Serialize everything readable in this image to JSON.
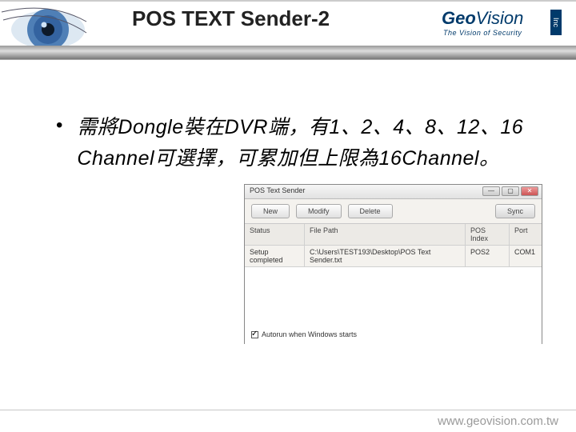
{
  "header": {
    "title": "POS TEXT Sender-2",
    "brand_name": "Geo",
    "brand_name2": "Vision",
    "brand_sub": "The Vision of Security",
    "inc": "Inc"
  },
  "bullet": {
    "dot": "•",
    "text": "需將Dongle裝在DVR端，有1、2、4、8、12、16 Channel可選擇，可累加但上限為16Channel。"
  },
  "shot": {
    "window_title": "POS Text Sender",
    "win_min": "—",
    "win_max": "▢",
    "win_close": "✕",
    "btn_new": "New",
    "btn_modify": "Modify",
    "btn_delete": "Delete",
    "btn_sync": "Sync",
    "col_status": "Status",
    "col_path": "File Path",
    "col_index": "POS Index",
    "col_port": "Port",
    "row_status": "Setup completed",
    "row_path": "C:\\Users\\TEST193\\Desktop\\POS Text Sender.txt",
    "row_index": "POS2",
    "row_port": "COM1",
    "autorun": "Autorun when Windows starts"
  },
  "footer": {
    "url": "www.geovision.com.tw"
  }
}
